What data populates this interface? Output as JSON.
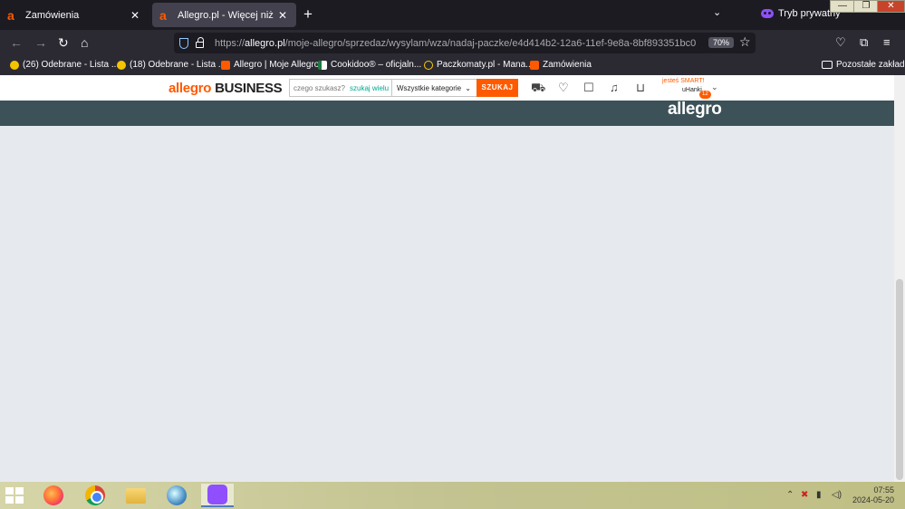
{
  "browser": {
    "tabs": [
      {
        "title": "Zamówienia",
        "icon": "allegro-a-icon",
        "close": "✕"
      },
      {
        "title": "Allegro.pl - Więcej niż aukcje. N",
        "icon": "allegro-a-icon",
        "close": "✕",
        "active": true
      }
    ],
    "new_tab": "+",
    "tab_list": "⌄",
    "private_label": "Tryb prywatny",
    "window_controls": {
      "minimize": "—",
      "maximize": "❐",
      "close": "✕"
    },
    "nav": {
      "back": "←",
      "forward": "→",
      "reload": "↻",
      "home": "⌂"
    },
    "url": {
      "prefix": "https://",
      "domain": "allegro.pl",
      "path": "/moje-allegro/sprzedaz/wysylam/wza/nadaj-paczke/e4d414b2-12a6-11ef-9e8a-8bf893351bc0"
    },
    "zoom": "70%",
    "bookmark_star": "☆",
    "toolbar_icons": {
      "pocket": "♡",
      "extensions": "⧉",
      "menu": "≡"
    }
  },
  "bookmarks": {
    "items": [
      {
        "label": "(26) Odebrane - Lista ...",
        "icon": "yellow-smiley-icon"
      },
      {
        "label": "(18) Odebrane - Lista ...",
        "icon": "yellow-smiley-icon"
      },
      {
        "label": "Allegro | Moje Allegro",
        "icon": "allegro-bag-icon"
      },
      {
        "label": "Cookidoo® – oficjaln...",
        "icon": "cookidoo-icon"
      },
      {
        "label": "Paczkomaty.pl - Mana...",
        "icon": "inpost-icon"
      },
      {
        "label": "Zamówienia",
        "icon": "allegro-bag-icon"
      }
    ],
    "other": "Pozostałe zakładki"
  },
  "allegro": {
    "logo_main": "allegro",
    "logo_business": "BUSINESS",
    "search_placeholder": "czego szukasz?",
    "search_many": "szukaj wielu",
    "category": "Wszystkie kategorie",
    "search_button": "SZUKAJ",
    "user_prefix": "jesteś",
    "user_smart": "SMART!",
    "username": "uHanki",
    "badge": "12",
    "caret": "⌄",
    "band_logo": "allegro"
  },
  "taskbar": {
    "time": "07:55",
    "date": "2024-05-20",
    "tray_icons": [
      "network-error-icon",
      "battery-icon",
      "volume-icon"
    ]
  },
  "colors": {
    "brand_orange": "#ff5a00",
    "band": "#3c5158",
    "page_bg": "#e6e9ee"
  }
}
